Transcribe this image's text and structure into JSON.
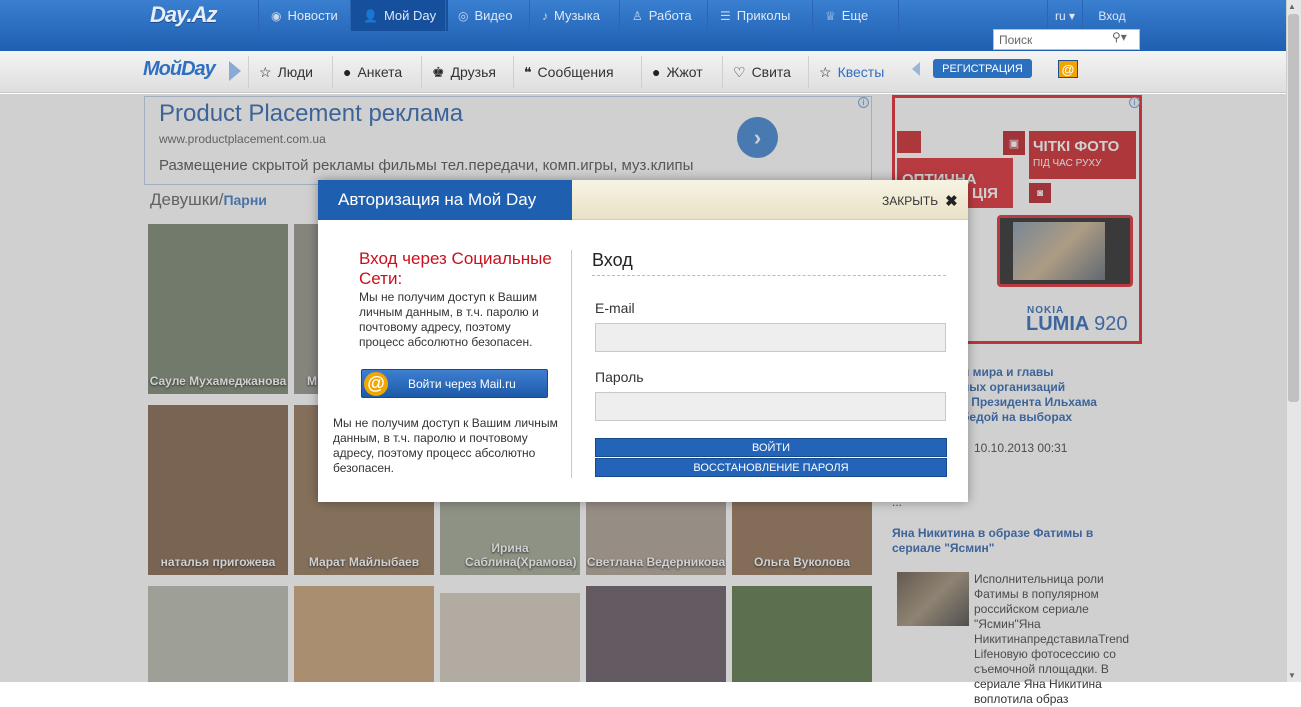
{
  "topnav": {
    "logo": "Day.Az",
    "items": [
      {
        "label": "Новости",
        "icon": "globe-icon"
      },
      {
        "label": "Мой Day",
        "icon": "user-icon"
      },
      {
        "label": "Видео",
        "icon": "film-icon"
      },
      {
        "label": "Музыка",
        "icon": "note-icon"
      },
      {
        "label": "Работа",
        "icon": "bag-icon"
      },
      {
        "label": "Приколы",
        "icon": "laugh-icon"
      },
      {
        "label": "Еще",
        "icon": "cup-icon"
      }
    ],
    "lang": "ru",
    "login": "Вход",
    "search_placeholder": "Поиск"
  },
  "subnav": {
    "logo": "МойDay",
    "items": [
      {
        "label": "Люди",
        "icon": "star-icon"
      },
      {
        "label": "Анкета",
        "icon": "profile-icon"
      },
      {
        "label": "Друзья",
        "icon": "friends-icon"
      },
      {
        "label": "Сообщения",
        "icon": "chat-icon"
      },
      {
        "label": "Жжот",
        "icon": "bomb-icon"
      },
      {
        "label": "Свита",
        "icon": "heart-icon"
      },
      {
        "label": "Квесты",
        "icon": "star-icon"
      }
    ],
    "register": "РЕГИСТРАЦИЯ",
    "mail_icon": "@"
  },
  "ad": {
    "title": "Product Placement реклама",
    "url": "www.productplacement.com.ua",
    "text": "Размещение скрытой рекламы фильмы тел.передачи, комп.игры, муз.клипы"
  },
  "tabs": {
    "girls": "Девушки",
    "sep": "/",
    "boys": "Парни"
  },
  "photos": [
    {
      "name": "Сауле Мухамеджанова",
      "color": "#6f7d64"
    },
    {
      "name": "М",
      "color": "#8c8a80"
    },
    {
      "name": "наталья пригожева",
      "color": "#7a5a3f"
    },
    {
      "name": "Марат Майлыбаев",
      "color": "#8a6a4a"
    },
    {
      "name": "Ирина Саблина(Храмова)",
      "color": "#9aa08a"
    },
    {
      "name": "Светлана Ведерникова",
      "color": "#a7988a"
    },
    {
      "name": "Ольга Вуколова",
      "color": "#8a6848"
    },
    {
      "name": "",
      "color": "#b2b5a8"
    },
    {
      "name": "",
      "color": "#c49a6a"
    },
    {
      "name": "",
      "color": "#cfc6b8"
    },
    {
      "name": "",
      "color": "#5a4a55"
    },
    {
      "name": "",
      "color": "#4e6a3a"
    }
  ],
  "banner": {
    "red_text1": "ОПТИЧНА",
    "red_text1b": "ЦІЯ",
    "red_text2": "ЧІТКІ ФОТО",
    "red_text2_small": "ПІД ЧАС РУХУ",
    "brand": "NOKIA",
    "model": "LUMIA",
    "model_num": "920"
  },
  "news": {
    "item1_lines": [
      "н мира и главы",
      "ных организаций",
      "т Президента Ильхама",
      "бедой на выборах"
    ],
    "item1_date": "10.10.2013 00:31",
    "ellipsis": "...",
    "item2_title": "Яна Никитина в образе Фатимы в сериале \"Ясмин\"",
    "item2_text": "Исполнительница роли Фатимы в популярном российском сериале \"Ясмин\"Яна НикитинапредставилаTrend Lifeновую фотосессию со съемочной площадки. В сериале Яна Никитина воплотила образ"
  },
  "modal": {
    "title": "Авторизация на Мой Day",
    "close": "ЗАКРЫТЬ",
    "social_title": "Вход через Социальные Сети:",
    "social_text": "Мы не получим доступ к Вашим личным данным, в т.ч. паролю и почтовому адресу, поэтому процесс абсолютно безопасен.",
    "mailru_btn": "Войти через Mail.ru",
    "social_text2": "Мы не получим доступ к Вашим личным данным, в т.ч. паролю и почтовому адресу, поэтому процесс абсолютно безопасен.",
    "login_title": "Вход",
    "email_label": "E-mail",
    "password_label": "Пароль",
    "login_btn": "ВОЙТИ",
    "restore_btn": "ВОССТАНОВЛЕНИЕ ПАРОЛЯ"
  }
}
